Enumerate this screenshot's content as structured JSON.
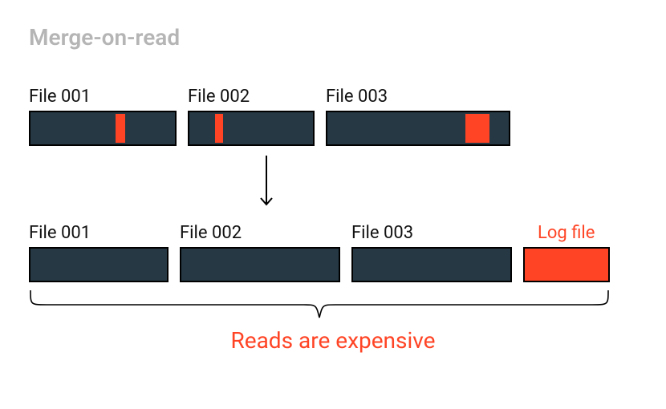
{
  "title": "Merge-on-read",
  "row_top": {
    "files": [
      {
        "label": "File 001"
      },
      {
        "label": "File 002"
      },
      {
        "label": "File 003"
      }
    ]
  },
  "row_bottom": {
    "files": [
      {
        "label": "File 001"
      },
      {
        "label": "File 002"
      },
      {
        "label": "File 003"
      }
    ],
    "log_label": "Log file"
  },
  "caption": "Reads are expensive"
}
